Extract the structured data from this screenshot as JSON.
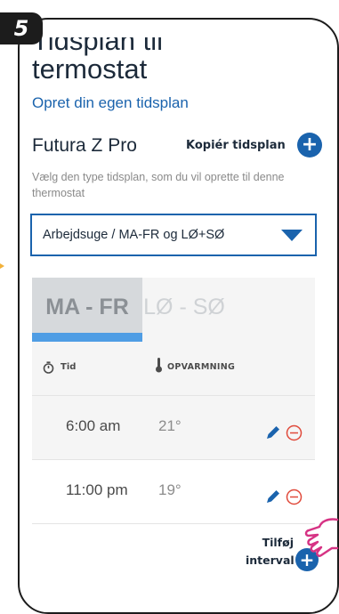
{
  "step_number": "5",
  "header": {
    "title_line1": "Tidsplan til",
    "title_line2": "termostat",
    "subtitle": "Opret din egen tidsplan"
  },
  "device": {
    "name": "Futura Z Pro",
    "copy_label": "Kopiér tidsplan",
    "copy_icon": "plus-circle-icon"
  },
  "help_text": "Vælg den type tidsplan, som du vil oprette til denne thermostat",
  "dropdown": {
    "selected": "Arbejdsuge / MA-FR og LØ+SØ"
  },
  "tabs": [
    {
      "label": "MA - FR",
      "active": true
    },
    {
      "label": "LØ - SØ",
      "active": false
    }
  ],
  "columns": {
    "time": "Tid",
    "heating": "OPVARMNING"
  },
  "intervals": [
    {
      "time": "6:00 am",
      "temp": "21°"
    },
    {
      "time": "11:00 pm",
      "temp": "19°"
    }
  ],
  "add_interval": {
    "line1": "Tilføj",
    "line2": "interval"
  },
  "colors": {
    "accent": "#1a63ad",
    "tab_indicator": "#4f9de4",
    "minus_red": "#e0493a",
    "pointer_hand": "#d63384"
  }
}
